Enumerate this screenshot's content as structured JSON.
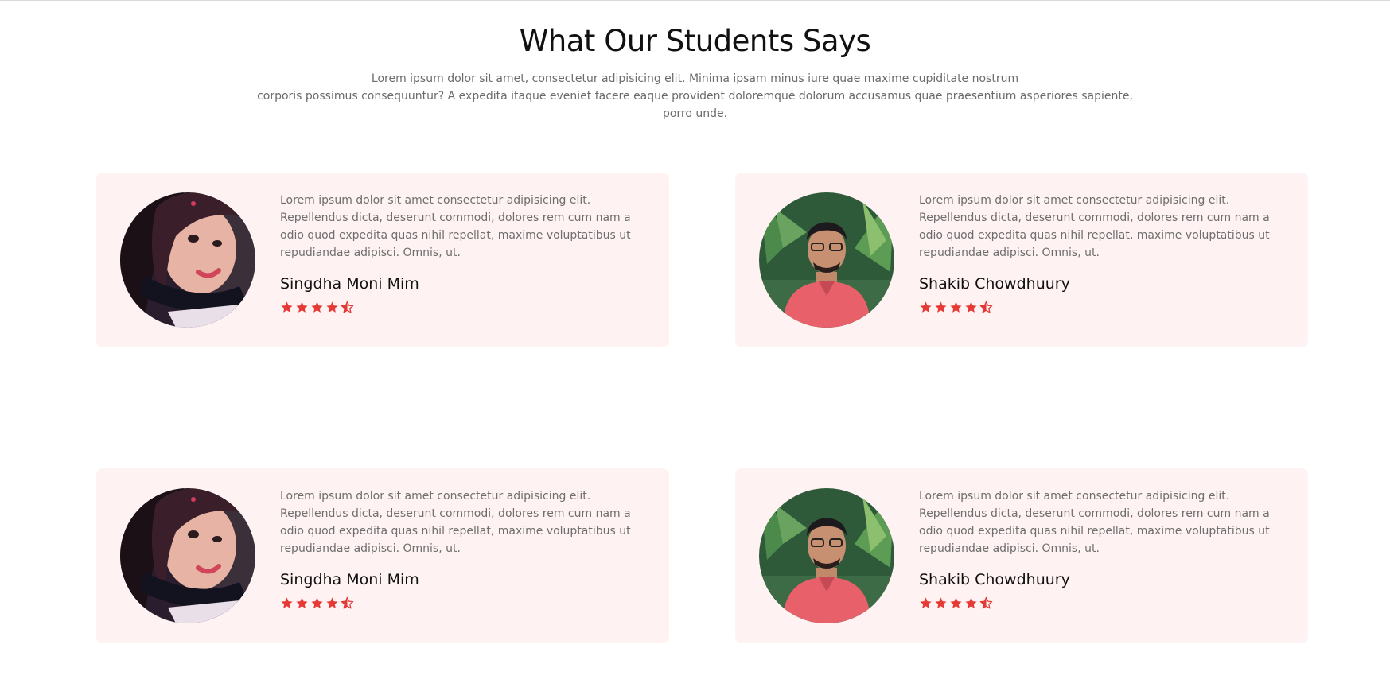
{
  "header": {
    "title": "What Our Students Says",
    "subtitle_line1": "Lorem ipsum dolor sit amet, consectetur adipisicing elit. Minima ipsam minus iure quae maxime cupiditate nostrum",
    "subtitle_line2": "corporis possimus consequuntur? A expedita itaque eveniet facere eaque provident doloremque dolorum accusamus quae praesentium asperiores sapiente, porro unde."
  },
  "colors": {
    "card_background": "#fff2f2",
    "star": "#e53935"
  },
  "testimonials": [
    {
      "name": "Singdha Moni Mim",
      "quote": "Lorem ipsum dolor sit amet consectetur adipisicing elit. Repellendus dicta, deserunt commodi, dolores rem cum nam a odio quod expedita quas nihil repellat, maxime voluptatibus ut repudiandae adipisci. Omnis, ut.",
      "rating": 4.5,
      "avatar_icon": "female-student-photo"
    },
    {
      "name": "Shakib Chowdhuury",
      "quote": "Lorem ipsum dolor sit amet consectetur adipisicing elit. Repellendus dicta, deserunt commodi, dolores rem cum nam a odio quod expedita quas nihil repellat, maxime voluptatibus ut repudiandae adipisci. Omnis, ut.",
      "rating": 4.5,
      "avatar_icon": "male-student-photo"
    },
    {
      "name": "Singdha Moni Mim",
      "quote": "Lorem ipsum dolor sit amet consectetur adipisicing elit. Repellendus dicta, deserunt commodi, dolores rem cum nam a odio quod expedita quas nihil repellat, maxime voluptatibus ut repudiandae adipisci. Omnis, ut.",
      "rating": 4.5,
      "avatar_icon": "female-student-photo"
    },
    {
      "name": "Shakib Chowdhuury",
      "quote": "Lorem ipsum dolor sit amet consectetur adipisicing elit. Repellendus dicta, deserunt commodi, dolores rem cum nam a odio quod expedita quas nihil repellat, maxime voluptatibus ut repudiandae adipisci. Omnis, ut.",
      "rating": 4.5,
      "avatar_icon": "male-student-photo"
    }
  ]
}
